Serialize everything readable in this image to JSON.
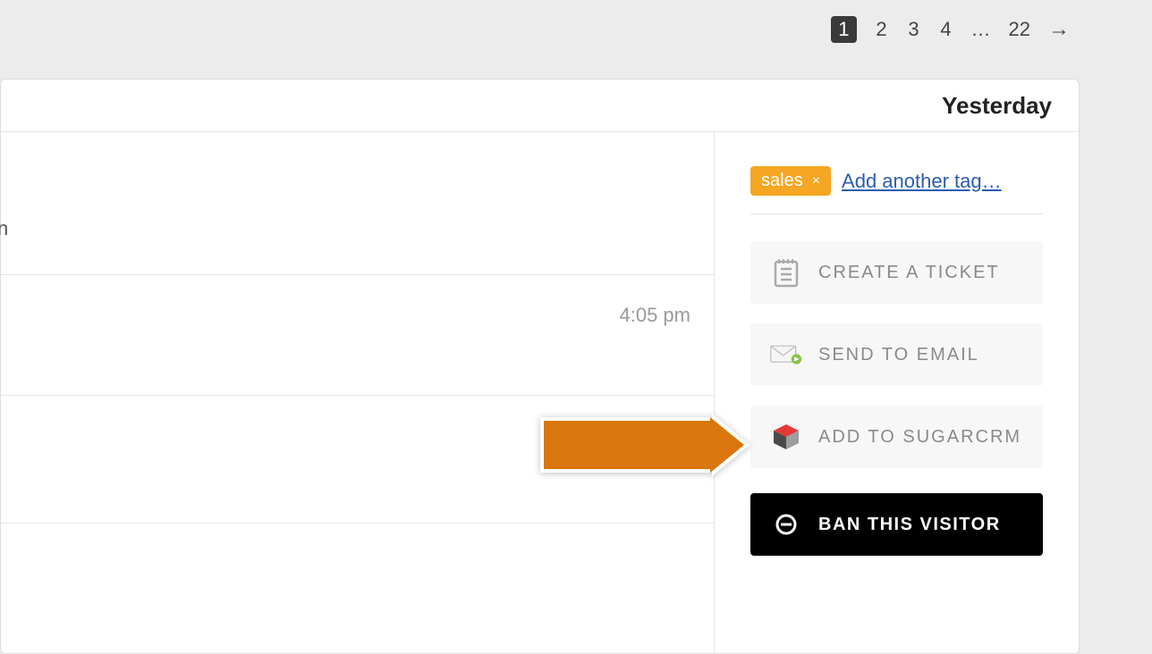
{
  "pagination": {
    "pages": [
      "1",
      "2",
      "3",
      "4"
    ],
    "ellipsis": "…",
    "last": "22",
    "arrow": "→",
    "active_index": 0
  },
  "header": {
    "title": "Yesterday"
  },
  "left": {
    "stray": "n",
    "timestamp": "4:05 pm"
  },
  "sidebar": {
    "tag": {
      "label": "sales",
      "remove": "×"
    },
    "add_tag": "Add another tag…",
    "actions": {
      "ticket": "CREATE A TICKET",
      "email": "SEND TO EMAIL",
      "sugarcrm": "ADD TO SUGARCRM",
      "ban": "BAN THIS VISITOR"
    }
  }
}
